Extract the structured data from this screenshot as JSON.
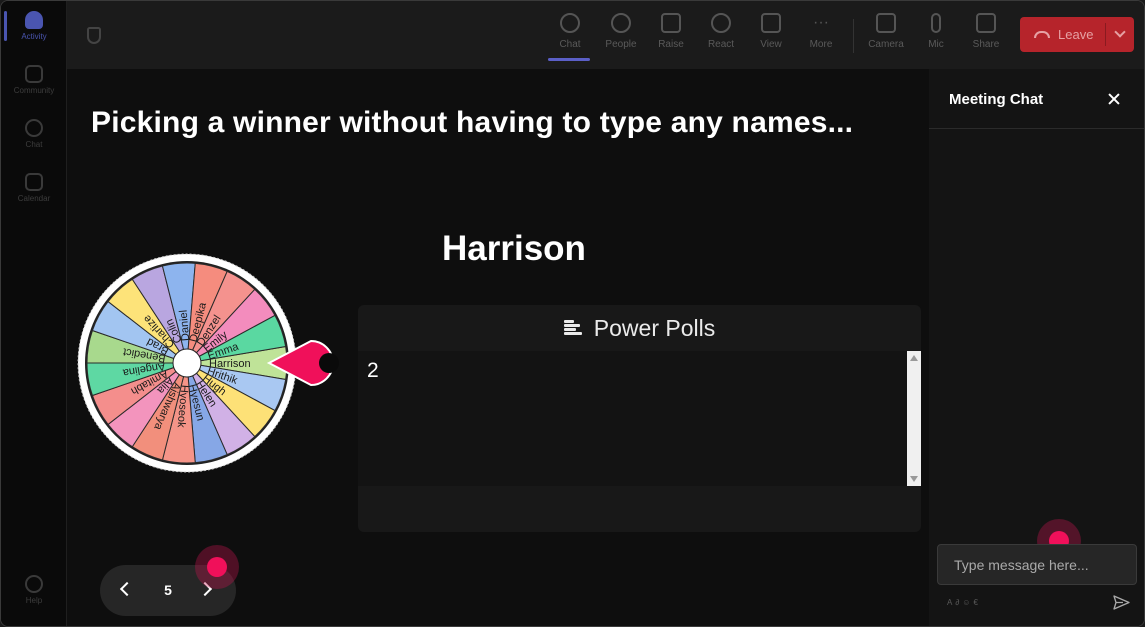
{
  "rail": {
    "items": [
      {
        "label": "Activity",
        "active": true
      },
      {
        "label": "Community",
        "active": false
      },
      {
        "label": "Chat",
        "active": false
      },
      {
        "label": "Calendar",
        "active": false
      }
    ],
    "help_label": "Help"
  },
  "toolbar": {
    "items": [
      {
        "label": "Chat",
        "icon": "chat-icon",
        "active": true
      },
      {
        "label": "People",
        "icon": "people-icon",
        "active": false
      },
      {
        "label": "Raise",
        "icon": "hand-icon",
        "active": false
      },
      {
        "label": "React",
        "icon": "smile-icon",
        "active": false
      },
      {
        "label": "View",
        "icon": "grid-icon",
        "active": false
      },
      {
        "label": "More",
        "icon": "more-icon",
        "active": false
      },
      {
        "label": "Camera",
        "icon": "camera-icon",
        "active": false
      },
      {
        "label": "Mic",
        "icon": "mic-icon",
        "active": false
      },
      {
        "label": "Share",
        "icon": "share-icon",
        "active": false
      }
    ],
    "leave_label": "Leave",
    "leave_color": "#b6242b"
  },
  "stage": {
    "headline": "Picking a winner without having to type any names...",
    "winner": "Harrison"
  },
  "wheel": {
    "names": [
      "Harrison",
      "Hrithik",
      "Hugh",
      "Helen",
      "Hyesun",
      "Hyoseok",
      "Aishwarya",
      "Alia",
      "Amitabh",
      "Angelina",
      "Benedict",
      "Brad",
      "Charlize",
      "Colin",
      "Daniel",
      "Deepika",
      "Denzel",
      "Emily",
      "Emma"
    ],
    "colors": [
      "#bfe398",
      "#a9c8f2",
      "#fde177",
      "#d1b1e6",
      "#86a7e6",
      "#f59488",
      "#f28f7c",
      "#f394bd",
      "#f48e8c",
      "#5ed8a3",
      "#a8d98d",
      "#a2c5f1",
      "#fde379",
      "#b9a6e0",
      "#8db4ee",
      "#f58c7e",
      "#f4928e",
      "#f38cbd",
      "#5ad8a1"
    ],
    "pointer_color": "#f0105a"
  },
  "polls": {
    "title": "Power Polls",
    "value": "2"
  },
  "pager": {
    "page": "5"
  },
  "chat": {
    "title": "Meeting Chat",
    "input_placeholder": "Type message here..."
  }
}
